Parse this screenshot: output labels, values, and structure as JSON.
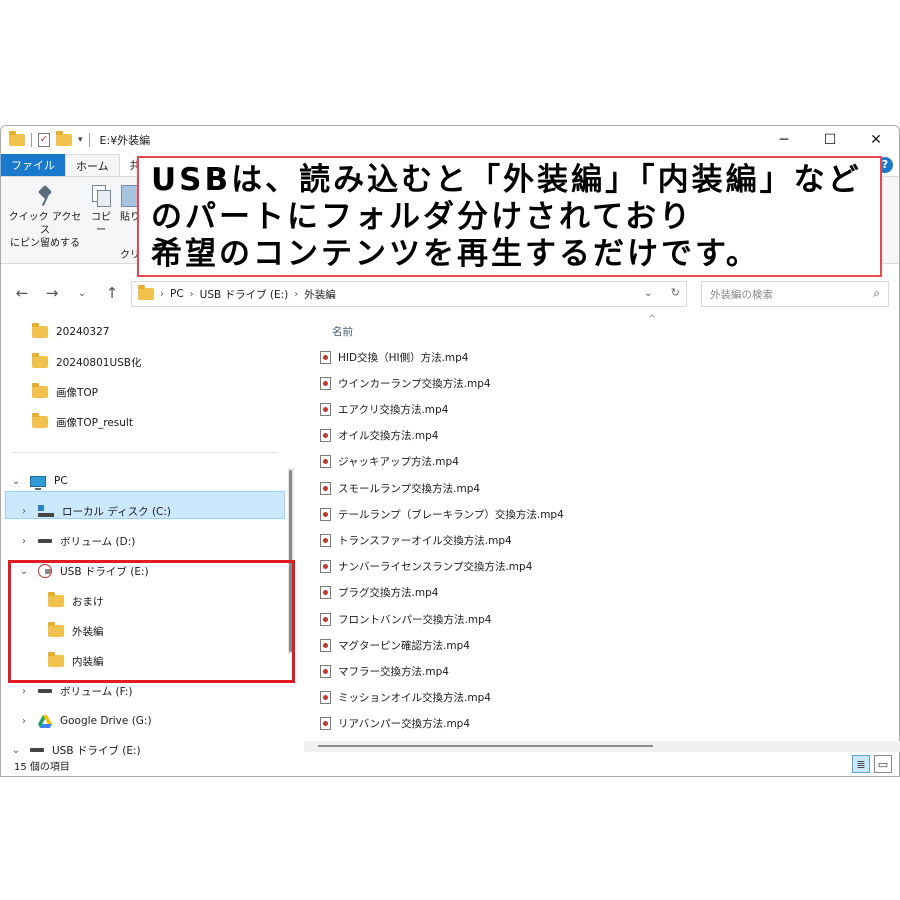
{
  "window": {
    "title": "E:¥外装編",
    "controls": {
      "minimize": "─",
      "maximize": "☐",
      "close": "✕"
    }
  },
  "ribbon": {
    "tabs": [
      {
        "label": "ファイル"
      },
      {
        "label": "ホーム"
      },
      {
        "label": "共有"
      }
    ],
    "help": "?",
    "items": {
      "pin": "クイック アクセス\nにピン留めする",
      "copy": "コピー",
      "paste": "貼り",
      "group": "クリ"
    }
  },
  "address": {
    "segments": [
      "PC",
      "USB ドライブ (E:)",
      "外装編"
    ],
    "search_placeholder": "外装編の検索"
  },
  "nav": {
    "quick_items": [
      "20240327",
      "20240801USB化",
      "画像TOP",
      "画像TOP_result"
    ],
    "pc": "PC",
    "drives": [
      {
        "label": "ローカル ディスク (C:)",
        "icon": "local-disk-icon"
      },
      {
        "label": "ボリューム (D:)",
        "icon": "drive-icon"
      },
      {
        "label": "USB ドライブ (E:)",
        "icon": "usb-drive-icon"
      }
    ],
    "usb_children": [
      "おまけ",
      "外装編",
      "内装編"
    ],
    "drives_after": [
      {
        "label": "ボリューム (F:)",
        "icon": "drive-icon"
      },
      {
        "label": "Google Drive (G:)",
        "icon": "google-drive-icon"
      },
      {
        "label": "USB ドライブ (E:)",
        "icon": "drive-icon"
      }
    ]
  },
  "files": {
    "column_name": "名前",
    "items": [
      "HID交換（HI側）方法.mp4",
      "ウインカーランプ交換方法.mp4",
      "エアクリ交換方法.mp4",
      "オイル交換方法.mp4",
      "ジャッキアップ方法.mp4",
      "スモールランプ交換方法.mp4",
      "テールランプ（ブレーキランプ）交換方法.mp4",
      "トランスファーオイル交換方法.mp4",
      "ナンバーライセンスランプ交換方法.mp4",
      "プラグ交換方法.mp4",
      "フロントバンパー交換方法.mp4",
      "マグターピン確認方法.mp4",
      "マフラー交換方法.mp4",
      "ミッションオイル交換方法.mp4",
      "リアバンパー交換方法.mp4"
    ]
  },
  "status": {
    "count": "15 個の項目"
  },
  "callout": {
    "lines": [
      "USBは、読み込むと「外装編」「内装編」など",
      "のパートにフォルダ分けされており",
      "希望のコンテンツを再生するだけです。"
    ]
  },
  "colors": {
    "accent": "#1979ca",
    "selection": "#cce8ff",
    "annotation_red": "#e01b22"
  }
}
